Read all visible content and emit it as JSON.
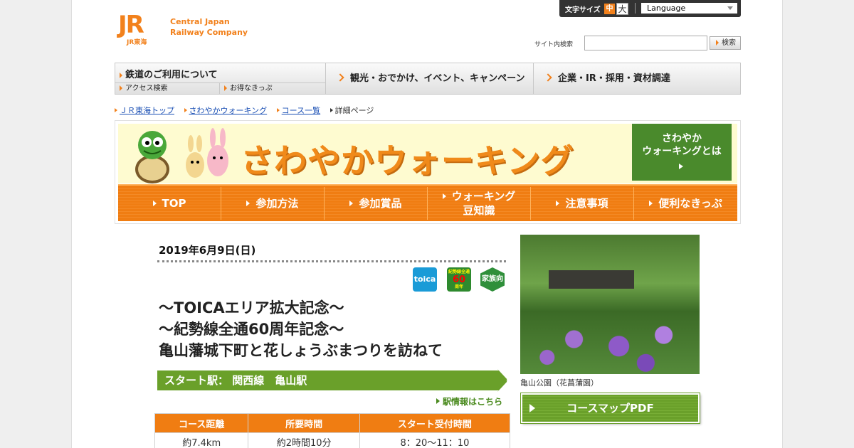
{
  "header": {
    "logo_jr": "JR",
    "logo_sub": "JR東海",
    "company_line1": "Central Japan",
    "company_line2": "Railway Company",
    "font_size_label": "文字サイズ",
    "font_size_mid": "中",
    "font_size_large": "大",
    "language_label": "Language",
    "site_search_label": "サイト内検索",
    "search_value": "",
    "search_button": "検索"
  },
  "global_nav": {
    "rail": "鉄道のご利用について",
    "access": "アクセス検索",
    "tickets": "お得なきっぷ",
    "tourism": "観光・おでかけ、イベント、キャンペーン",
    "corporate": "企業・IR・採用・資材調達"
  },
  "breadcrumb": [
    "ＪＲ東海トップ",
    "さわやかウォーキング",
    "コース一覧",
    "詳細ページ"
  ],
  "banner": {
    "title": "さわやかウォーキング",
    "about_line1": "さわやか",
    "about_line2": "ウォーキングとは",
    "nav": [
      "TOP",
      "参加方法",
      "参加賞品",
      "ウォーキング",
      "豆知識",
      "注意事項",
      "便利なきっぷ"
    ]
  },
  "event": {
    "date": "2019年6月9日(日)",
    "badges": {
      "toica": "toica",
      "sixty_top": "紀勢線全通",
      "sixty_num": "60",
      "sixty_bottom": "周年",
      "family": "家族向"
    },
    "title_line1": "～TOICAエリア拡大記念～",
    "title_line2": "～紀勢線全通60周年記念～",
    "title_line3": "亀山藩城下町と花しょうぶまつりを訪ねて",
    "start_station": "スタート駅：  関西線　亀山駅",
    "station_info_link": "駅情報はこちら",
    "table_headers": [
      "コース距離",
      "所要時間",
      "スタート受付時間"
    ],
    "table_values": [
      "約7.4km",
      "約2時間10分",
      "8：20～11：10"
    ],
    "photo_caption": "亀山公園（花菖蒲園）",
    "pdf_button": "コースマップPDF"
  },
  "colors": {
    "brand_orange": "#f07d12",
    "walking_green": "#6aa02a",
    "jr_orange": "#f2811c"
  }
}
